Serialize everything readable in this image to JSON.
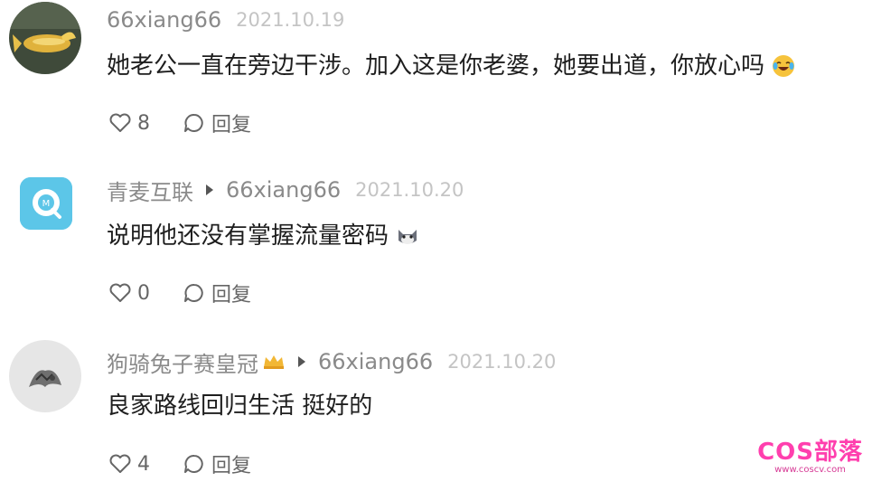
{
  "comments": [
    {
      "user": "66xiang66",
      "date": "2021.10.19",
      "text": "她老公一直在旁边干涉。加入这是你老婆，她要出道，你放心吗",
      "emoji": "laughing-crying-emoji",
      "likes": "8",
      "reply_label": "回复",
      "avatar": "golden-fish-avatar"
    },
    {
      "user": "青麦互联",
      "reply_to": "66xiang66",
      "date": "2021.10.20",
      "text": "说明他还没有掌握流量密码",
      "emoji": "cat-emoji",
      "likes": "0",
      "reply_label": "回复",
      "avatar": "app-logo-avatar"
    },
    {
      "user": "狗骑兔子赛皇冠",
      "reply_to": "66xiang66",
      "date": "2021.10.20",
      "text": "良家路线回归生活 挺好的",
      "likes": "4",
      "reply_label": "回复",
      "avatar": "sketch-avatar",
      "badge": "crown-icon"
    }
  ],
  "watermark": {
    "title": "COS部落",
    "url": "www.coscv.com"
  },
  "colors": {
    "meta": "#8a8a8a",
    "date": "#c4c4c4",
    "text": "#1e1e1e",
    "watermark": "#ff3fae"
  }
}
